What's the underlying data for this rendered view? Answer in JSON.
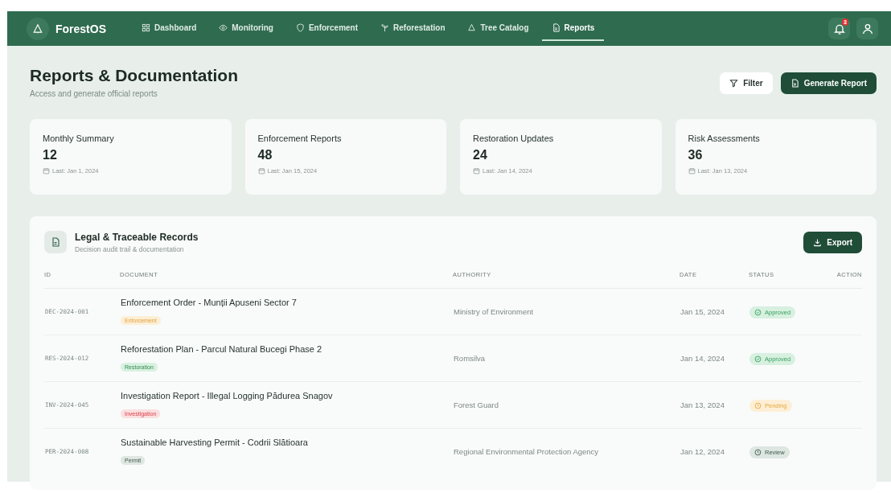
{
  "brand": "ForestOS",
  "nav": [
    {
      "label": "Dashboard",
      "selected": false
    },
    {
      "label": "Monitoring",
      "selected": false
    },
    {
      "label": "Enforcement",
      "selected": false
    },
    {
      "label": "Reforestation",
      "selected": false
    },
    {
      "label": "Tree Catalog",
      "selected": false
    },
    {
      "label": "Reports",
      "selected": true
    }
  ],
  "notifications": {
    "count": "3"
  },
  "page": {
    "title": "Reports & Documentation",
    "subtitle": "Access and generate official reports"
  },
  "actions": {
    "filter": "Filter",
    "generate": "Generate Report"
  },
  "stats": [
    {
      "label": "Monthly Summary",
      "value": "12",
      "last": "Last: Jan 1, 2024"
    },
    {
      "label": "Enforcement Reports",
      "value": "48",
      "last": "Last: Jan 15, 2024"
    },
    {
      "label": "Restoration Updates",
      "value": "24",
      "last": "Last: Jan 14, 2024"
    },
    {
      "label": "Risk Assessments",
      "value": "36",
      "last": "Last: Jan 13, 2024"
    }
  ],
  "records": {
    "title": "Legal & Traceable Records",
    "subtitle": "Decision audit trail & documentation",
    "export": "Export",
    "columns": [
      "ID",
      "DOCUMENT",
      "AUTHORITY",
      "DATE",
      "STATUS",
      "ACTION"
    ],
    "rows": [
      {
        "id": "DEC-2024-001",
        "document": "Enforcement Order - Munții Apuseni Sector 7",
        "tag": {
          "text": "Enforcement",
          "kind": "enforcement"
        },
        "authority": "Ministry of Environment",
        "date": "Jan 15, 2024",
        "status": {
          "text": "Approved",
          "kind": "approved"
        }
      },
      {
        "id": "RES-2024-012",
        "document": "Reforestation Plan - Parcul Natural Bucegi Phase 2",
        "tag": {
          "text": "Restoration",
          "kind": "restoration"
        },
        "authority": "Romsilva",
        "date": "Jan 14, 2024",
        "status": {
          "text": "Approved",
          "kind": "approved"
        }
      },
      {
        "id": "INV-2024-045",
        "document": "Investigation Report - Illegal Logging Pădurea Snagov",
        "tag": {
          "text": "Investigation",
          "kind": "investigation"
        },
        "authority": "Forest Guard",
        "date": "Jan 13, 2024",
        "status": {
          "text": "Pending",
          "kind": "pending"
        }
      },
      {
        "id": "PER-2024-008",
        "document": "Sustainable Harvesting Permit - Codrii Slătioara",
        "tag": {
          "text": "Permit",
          "kind": "permit"
        },
        "authority": "Regional Environmental Protection Agency",
        "date": "Jan 12, 2024",
        "status": {
          "text": "Review",
          "kind": "review"
        }
      }
    ]
  }
}
